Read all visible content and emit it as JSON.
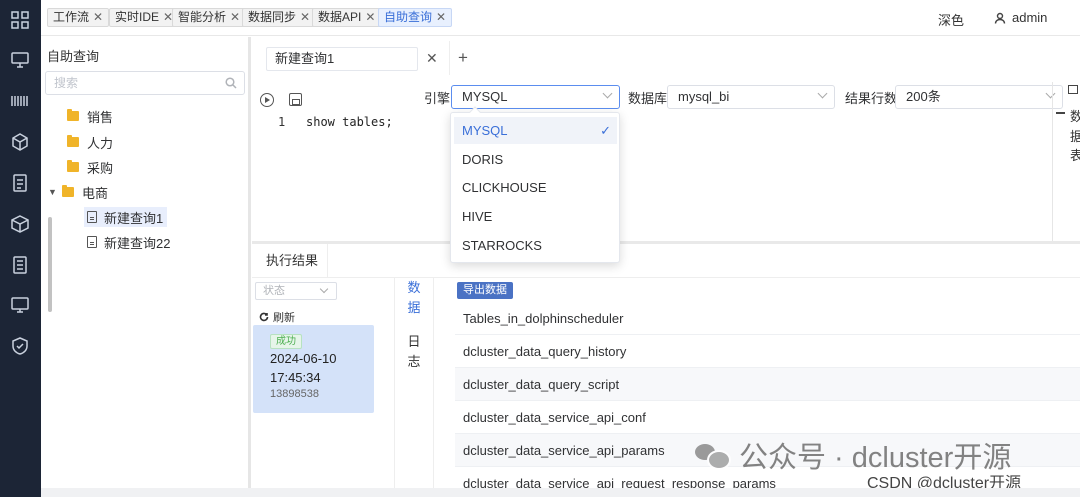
{
  "top_tabs": [
    {
      "label": "工作流"
    },
    {
      "label": "实时IDE"
    },
    {
      "label": "智能分析"
    },
    {
      "label": "数据同步"
    },
    {
      "label": "数据API"
    },
    {
      "label": "自助查询"
    }
  ],
  "close_glyph": "✕",
  "header": {
    "theme_label": "深色",
    "user_name": "admin"
  },
  "left_panel": {
    "title": "自助查询",
    "search_placeholder": "搜索",
    "tree": [
      {
        "label": "销售"
      },
      {
        "label": "人力"
      },
      {
        "label": "采购"
      },
      {
        "label": "电商"
      },
      {
        "label": "新建查询1"
      },
      {
        "label": "新建查询22"
      }
    ]
  },
  "editor": {
    "query_tab": "新建查询1",
    "add_tab": "+",
    "engine_label": "引擎:",
    "engine_value": "MYSQL",
    "db_label": "数据库:",
    "db_value": "mysql_bi",
    "rows_label": "结果行数:",
    "rows_value": "200条",
    "line_number": "1",
    "code": "show tables;",
    "side_panel_text": [
      "数",
      "据",
      "表"
    ]
  },
  "engine_options": [
    {
      "label": "MYSQL",
      "selected": true
    },
    {
      "label": "DORIS"
    },
    {
      "label": "CLICKHOUSE"
    },
    {
      "label": "HIVE"
    },
    {
      "label": "STARROCKS"
    }
  ],
  "check_glyph": "✓",
  "results": {
    "tab_label": "执行结果",
    "status_placeholder": "状态",
    "refresh_label": "刷新",
    "history": {
      "badge": "成功",
      "date": "2024-06-10",
      "time": "17:45:34",
      "id": "13898538"
    },
    "vtab_data": [
      "数",
      "据"
    ],
    "vtab_log": [
      "日",
      "志"
    ],
    "export_label": "导出数据",
    "column_header": "Tables_in_dolphinscheduler",
    "rows": [
      "dcluster_data_query_history",
      "dcluster_data_query_script",
      "dcluster_data_service_api_conf",
      "dcluster_data_service_api_params",
      "dcluster_data_service_api_request_response_params"
    ]
  },
  "watermark": {
    "main": "公众号 · dcluster开源",
    "csdn": "CSDN @dcluster开源"
  }
}
